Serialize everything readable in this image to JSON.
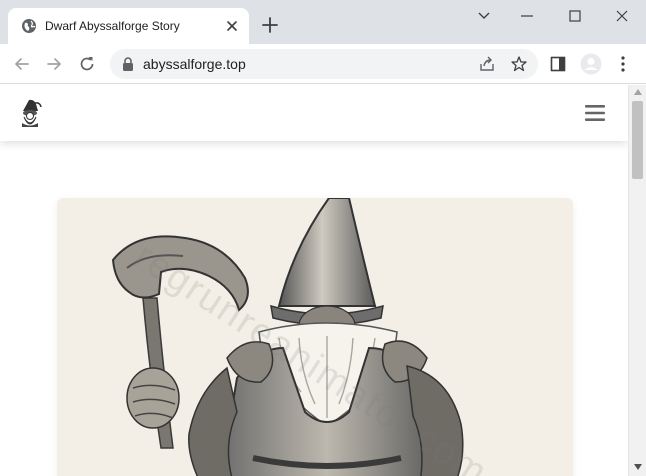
{
  "browser": {
    "tab": {
      "title": "Dwarf Abyssalforge Story",
      "favicon": "globe-icon"
    },
    "address_bar": {
      "url": "abyssalforge.top"
    }
  },
  "site": {
    "logo": "gnome-logo-icon",
    "watermark": "regrunreanimator.com",
    "hero_image": "gnome-with-axe-sketch"
  },
  "colors": {
    "tabstrip": "#dee1e6",
    "omnibox": "#f1f3f4",
    "hero_bg": "#f3efe6"
  }
}
